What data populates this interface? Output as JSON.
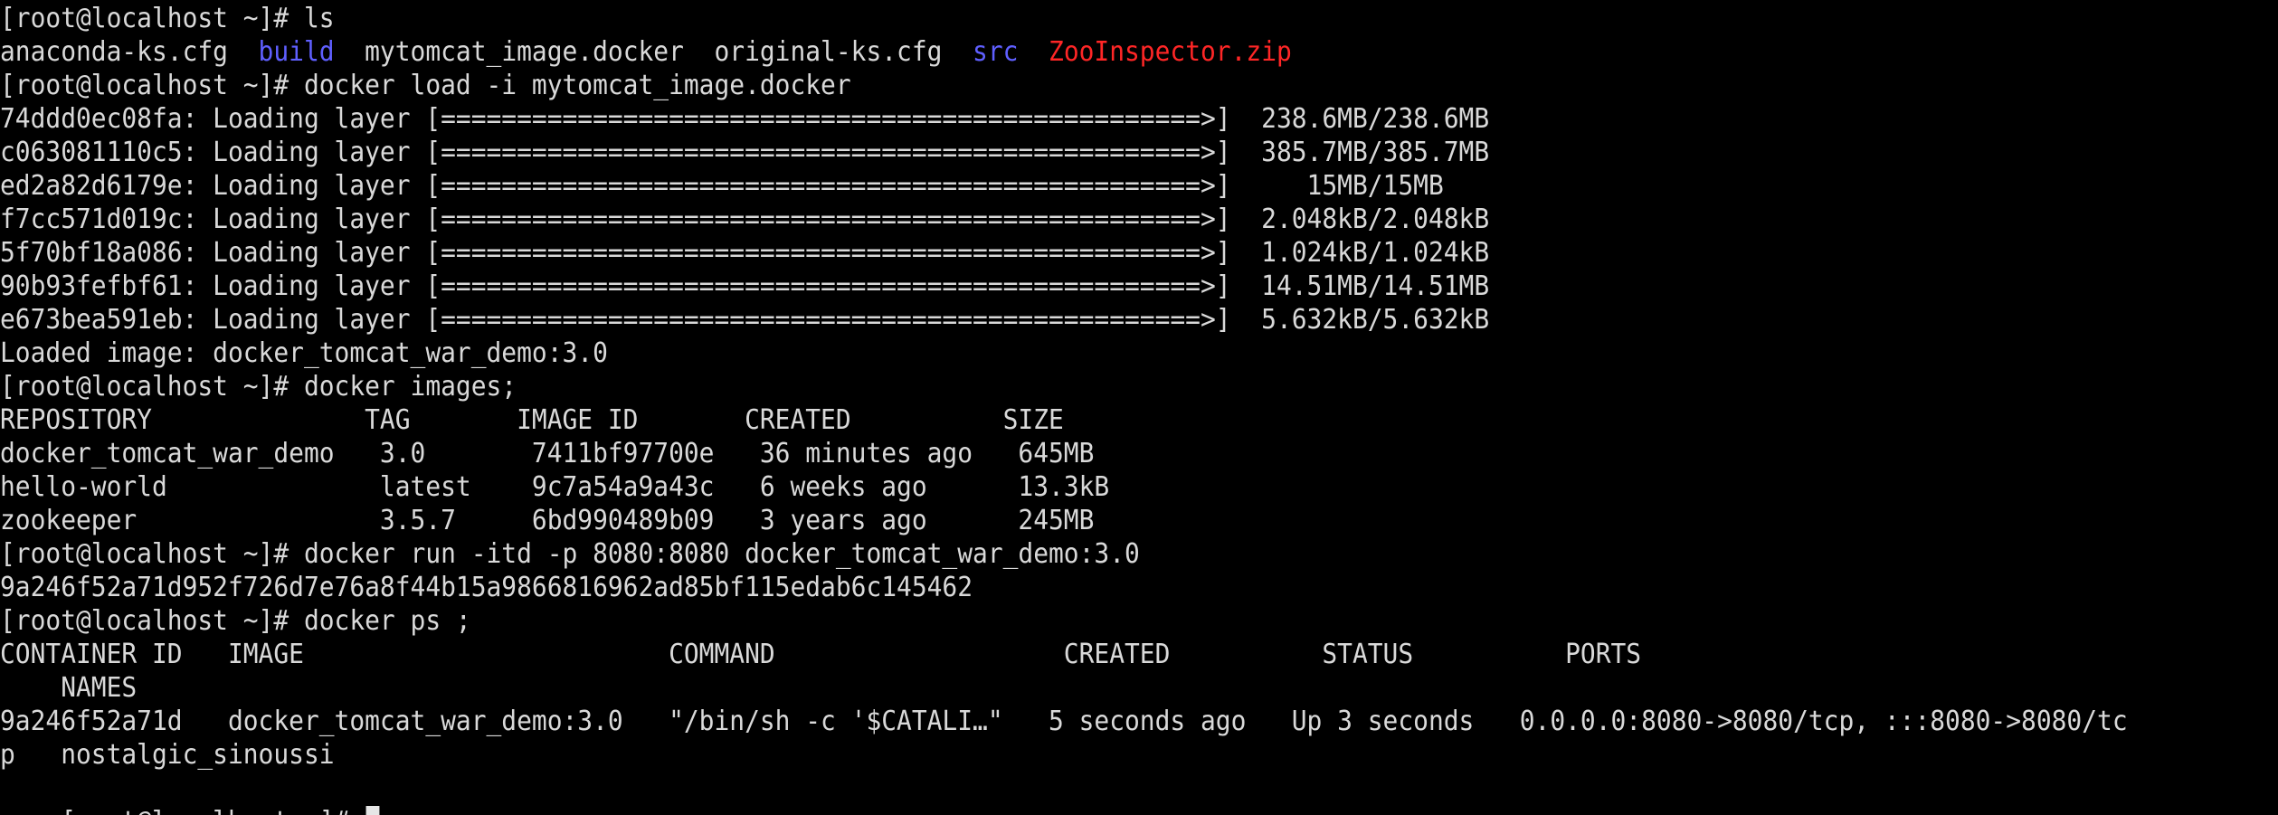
{
  "terminal": {
    "prompt": "[root@localhost ~]# ",
    "lines": [
      {
        "segments": [
          {
            "text": "[root@localhost ~]# ls",
            "style": "normal"
          }
        ]
      },
      {
        "segments": [
          {
            "text": "anaconda-ks.cfg  ",
            "style": "normal"
          },
          {
            "text": "build",
            "style": "directory"
          },
          {
            "text": "  mytomcat_image.docker  original-ks.cfg  ",
            "style": "normal"
          },
          {
            "text": "src",
            "style": "directory"
          },
          {
            "text": "  ",
            "style": "normal"
          },
          {
            "text": "ZooInspector.zip",
            "style": "archive"
          }
        ]
      },
      {
        "segments": [
          {
            "text": "[root@localhost ~]# docker load -i mytomcat_image.docker",
            "style": "normal"
          }
        ]
      },
      {
        "segments": [
          {
            "text": "74ddd0ec08fa: Loading layer [==================================================>]  238.6MB/238.6MB",
            "style": "normal"
          }
        ]
      },
      {
        "segments": [
          {
            "text": "c063081110c5: Loading layer [==================================================>]  385.7MB/385.7MB",
            "style": "normal"
          }
        ]
      },
      {
        "segments": [
          {
            "text": "ed2a82d6179e: Loading layer [==================================================>]     15MB/15MB",
            "style": "normal"
          }
        ]
      },
      {
        "segments": [
          {
            "text": "f7cc571d019c: Loading layer [==================================================>]  2.048kB/2.048kB",
            "style": "normal"
          }
        ]
      },
      {
        "segments": [
          {
            "text": "5f70bf18a086: Loading layer [==================================================>]  1.024kB/1.024kB",
            "style": "normal"
          }
        ]
      },
      {
        "segments": [
          {
            "text": "90b93fefbf61: Loading layer [==================================================>]  14.51MB/14.51MB",
            "style": "normal"
          }
        ]
      },
      {
        "segments": [
          {
            "text": "e673bea591eb: Loading layer [==================================================>]  5.632kB/5.632kB",
            "style": "normal"
          }
        ]
      },
      {
        "segments": [
          {
            "text": "Loaded image: docker_tomcat_war_demo:3.0",
            "style": "normal"
          }
        ]
      },
      {
        "segments": [
          {
            "text": "[root@localhost ~]# docker images;",
            "style": "normal"
          }
        ]
      },
      {
        "segments": [
          {
            "text": "REPOSITORY              TAG       IMAGE ID       CREATED          SIZE",
            "style": "normal"
          }
        ]
      },
      {
        "segments": [
          {
            "text": "docker_tomcat_war_demo   3.0       7411bf97700e   36 minutes ago   645MB",
            "style": "normal"
          }
        ]
      },
      {
        "segments": [
          {
            "text": "hello-world              latest    9c7a54a9a43c   6 weeks ago      13.3kB",
            "style": "normal"
          }
        ]
      },
      {
        "segments": [
          {
            "text": "zookeeper                3.5.7     6bd990489b09   3 years ago      245MB",
            "style": "normal"
          }
        ]
      },
      {
        "segments": [
          {
            "text": "[root@localhost ~]# docker run -itd -p 8080:8080 docker_tomcat_war_demo:3.0",
            "style": "normal"
          }
        ]
      },
      {
        "segments": [
          {
            "text": "9a246f52a71d952f726d7e76a8f44b15a9866816962ad85bf115edab6c145462",
            "style": "normal"
          }
        ]
      },
      {
        "segments": [
          {
            "text": "[root@localhost ~]# docker ps ;",
            "style": "normal"
          }
        ]
      },
      {
        "segments": [
          {
            "text": "CONTAINER ID   IMAGE                        COMMAND                   CREATED          STATUS          PORTS",
            "style": "normal"
          }
        ]
      },
      {
        "segments": [
          {
            "text": "    NAMES",
            "style": "normal"
          }
        ]
      },
      {
        "segments": [
          {
            "text": "9a246f52a71d   docker_tomcat_war_demo:3.0   \"/bin/sh -c '$CATALI…\"   5 seconds ago   Up 3 seconds   0.0.0.0:8080->8080/tcp, :::8080->8080/tc",
            "style": "normal"
          }
        ]
      },
      {
        "segments": [
          {
            "text": "p   nostalgic_sinoussi",
            "style": "normal"
          }
        ]
      }
    ]
  },
  "colors": {
    "background": "#000000",
    "foreground": "#d9d9d9",
    "directory": "#5f5fff",
    "archive": "#ff2626",
    "cursor": "#e6e6e6"
  }
}
